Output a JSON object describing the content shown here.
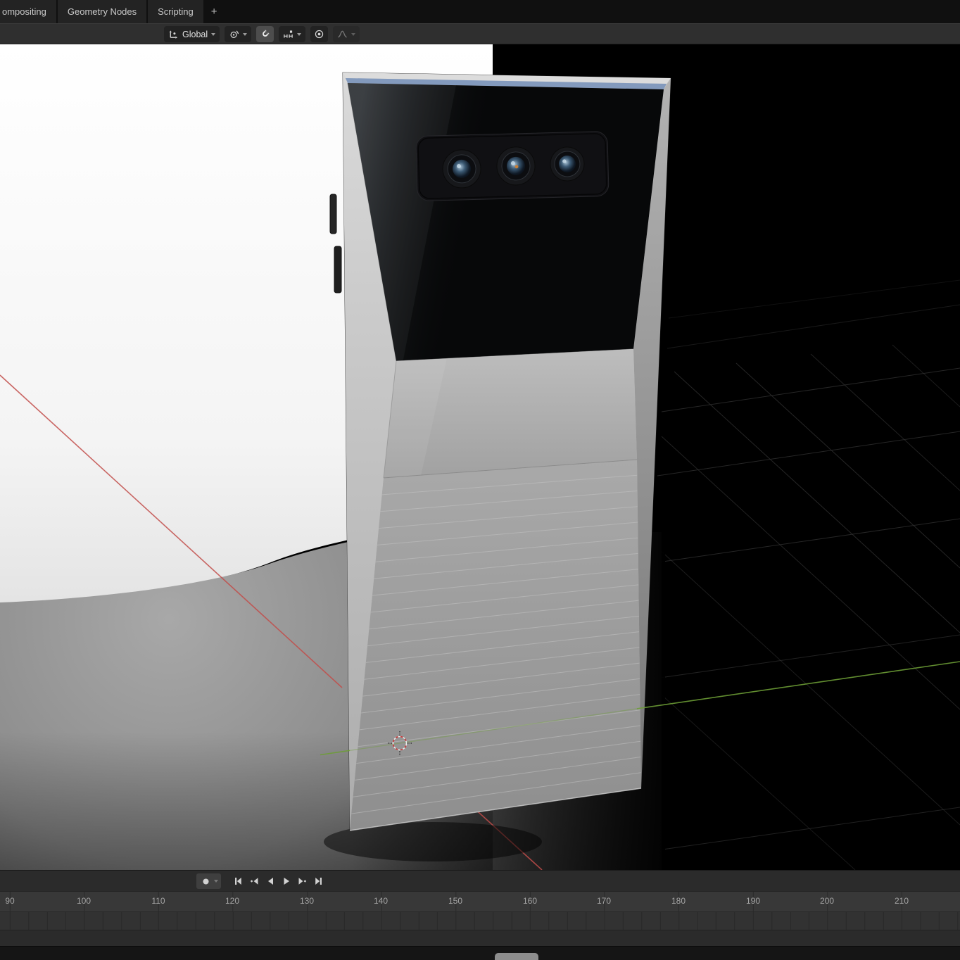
{
  "topbar": {
    "tabs": [
      {
        "label": "ompositing"
      },
      {
        "label": "Geometry Nodes"
      },
      {
        "label": "Scripting"
      }
    ],
    "add_tab": "+"
  },
  "viewport_header": {
    "orientation_value": "Global",
    "snap_enabled": true,
    "icons": {
      "orientation": "axis-gizmo",
      "pivot": "pivot-point",
      "snap": "magnet",
      "snap_with": "increment-grid",
      "proportional": "circle-dot",
      "falloff": "smooth-curve",
      "dropdown": "chevron-down"
    }
  },
  "viewport": {
    "scene_objects": [
      "phone-model",
      "white-backdrop",
      "studio-floor"
    ],
    "colors": {
      "axis_x": "#c24d4a",
      "axis_y": "#6d9e36",
      "background": "#000000"
    }
  },
  "timeline": {
    "playback_buttons": [
      "auto-key-record",
      "jump-to-start",
      "previous-keyframe",
      "play-reverse",
      "play",
      "next-keyframe",
      "jump-to-end"
    ],
    "ruler_ticks": [
      "90",
      "100",
      "110",
      "120",
      "130",
      "140",
      "150",
      "160",
      "170",
      "180",
      "190",
      "200",
      "210"
    ]
  }
}
